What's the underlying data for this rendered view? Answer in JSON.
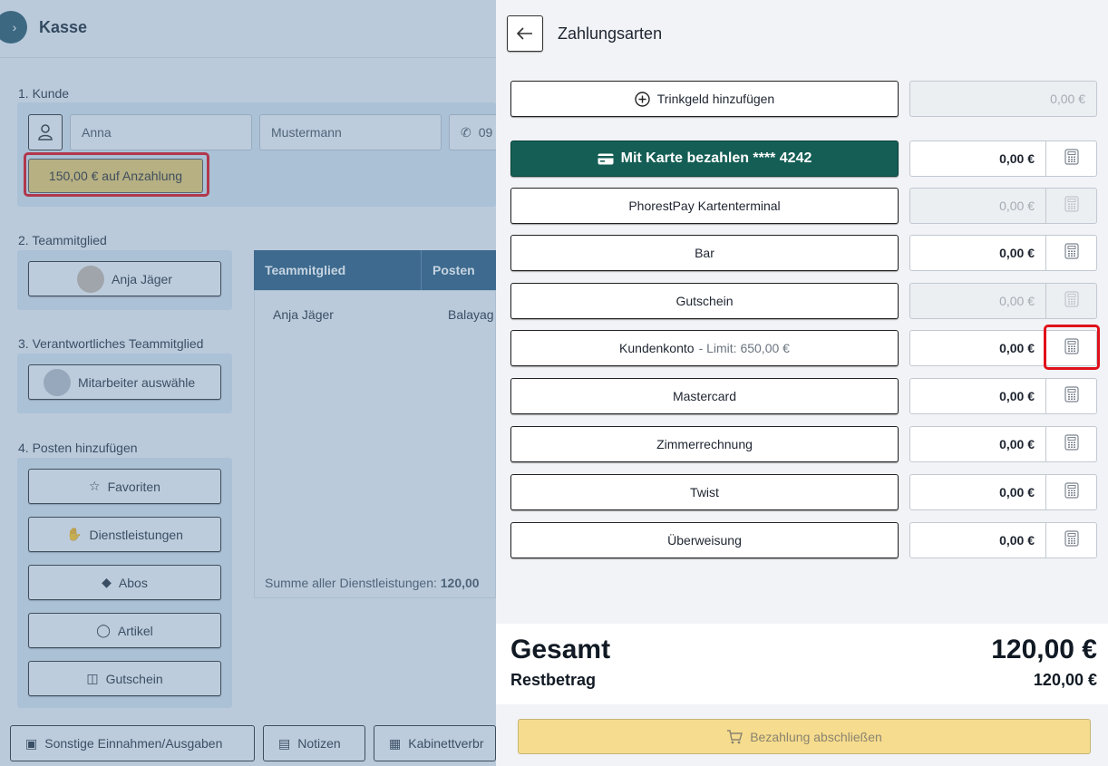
{
  "app": {
    "title": "Kasse",
    "sections": {
      "customer": "1. Kunde",
      "team_member": "2. Teammitglied",
      "responsible": "3. Verantwortliches Teammitglied",
      "add_items": "4. Posten hinzufügen"
    },
    "customer": {
      "first_name": "Anna",
      "last_name": "Mustermann",
      "phone_partial": "09",
      "deposit_label": "150,00 € auf Anzahlung"
    },
    "team_member_name": "Anja Jäger",
    "responsible_placeholder": "Mitarbeiter auswähle",
    "item_buttons": [
      "Favoriten",
      "Dienstleistungen",
      "Abos",
      "Artikel",
      "Gutschein"
    ],
    "table": {
      "headers": [
        "Teammitglied",
        "Posten"
      ],
      "rows": [
        [
          "Anja Jäger",
          "Balayag"
        ]
      ],
      "sum_label": "Summe aller Dienstleistungen:",
      "sum_value": "120,00"
    },
    "bottom_buttons": [
      "Sonstige Einnahmen/Ausgaben",
      "Notizen",
      "Kabinettverbr"
    ]
  },
  "panel": {
    "title": "Zahlungsarten",
    "tip": {
      "label": "Trinkgeld hinzufügen",
      "amount": "0,00 €"
    },
    "methods": [
      {
        "label": "Mit Karte bezahlen **** 4242",
        "amount": "0,00 €",
        "disabled": false,
        "primary": true
      },
      {
        "label": "PhorestPay Kartenterminal",
        "amount": "0,00 €",
        "disabled": true
      },
      {
        "label": "Bar",
        "amount": "0,00 €",
        "disabled": false
      },
      {
        "label": "Gutschein",
        "amount": "0,00 €",
        "disabled": true
      },
      {
        "label": "Kundenkonto",
        "limit": "- Limit: 650,00 €",
        "amount": "0,00 €",
        "disabled": false
      },
      {
        "label": "Mastercard",
        "amount": "0,00 €",
        "disabled": false
      },
      {
        "label": "Zimmerrechnung",
        "amount": "0,00 €",
        "disabled": false
      },
      {
        "label": "Twist",
        "amount": "0,00 €",
        "disabled": false
      },
      {
        "label": "Überweisung",
        "amount": "0,00 €",
        "disabled": false
      }
    ],
    "total_label": "Gesamt",
    "total_value": "120,00 €",
    "rest_label": "Restbetrag",
    "rest_value": "120,00 €",
    "finish_label": "Bezahlung abschließen"
  },
  "colors": {
    "primary_green": "#145e55",
    "finish_yellow": "#f6dc8e",
    "highlight_red": "#e0111b",
    "table_header_blue": "#2f5f80"
  }
}
